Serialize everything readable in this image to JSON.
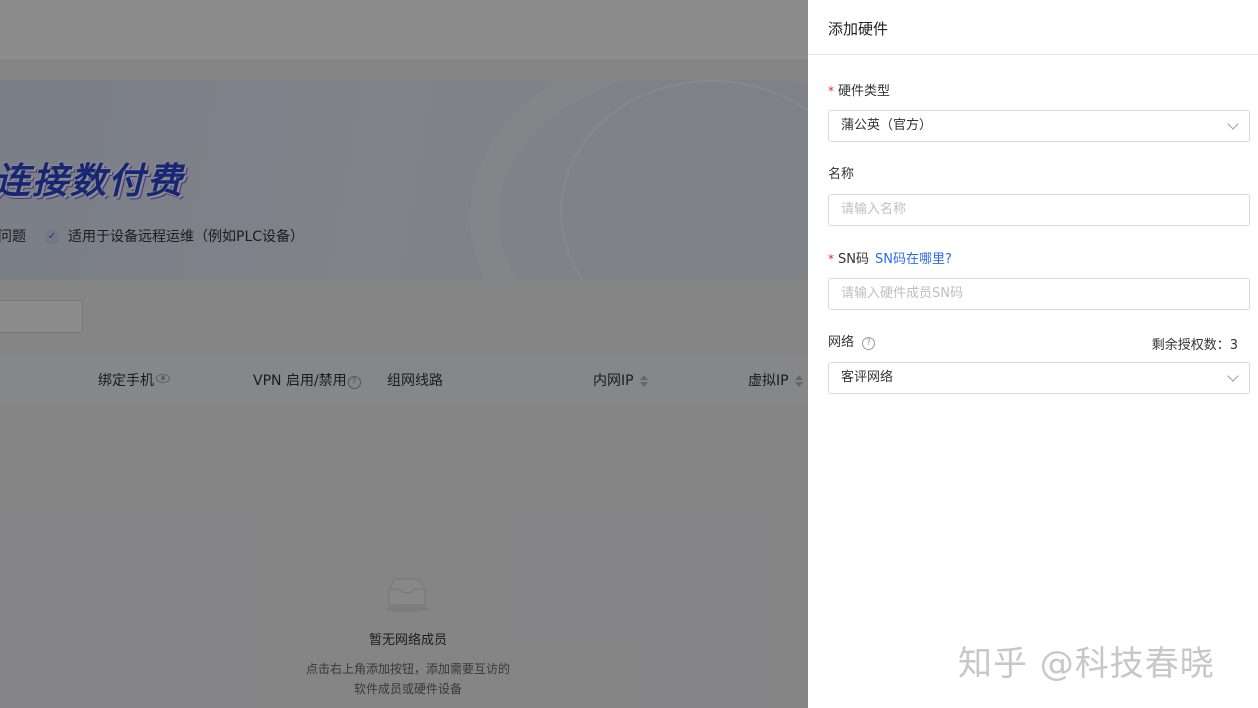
{
  "background": {
    "banner_title": "连接数付费",
    "banner_feature_1": "问题",
    "banner_feature_2": "适用于设备远程运维（例如PLC设备）",
    "table_columns": [
      "绑定手机",
      "VPN 启用/禁用",
      "组网线路",
      "内网IP",
      "虚拟IP"
    ],
    "empty_title": "暂无网络成员",
    "empty_desc_line1": "点击右上角添加按钮，添加需要互访的",
    "empty_desc_line2": "软件成员或硬件设备"
  },
  "drawer": {
    "title": "添加硬件",
    "hardware_type": {
      "label": "硬件类型",
      "value": "蒲公英（官方）"
    },
    "name": {
      "label": "名称",
      "placeholder": "请输入名称"
    },
    "sn": {
      "label": "SN码",
      "help_link": "SN码在哪里?",
      "placeholder": "请输入硬件成员SN码"
    },
    "network": {
      "label": "网络",
      "quota_text": "剩余授权数：3",
      "value": "客评网络"
    }
  },
  "watermark": "知乎 @科技春晓",
  "colors": {
    "accent": "#2b6de5",
    "required": "#f5222d",
    "overlay": "rgba(0,0,0,0.45)"
  }
}
